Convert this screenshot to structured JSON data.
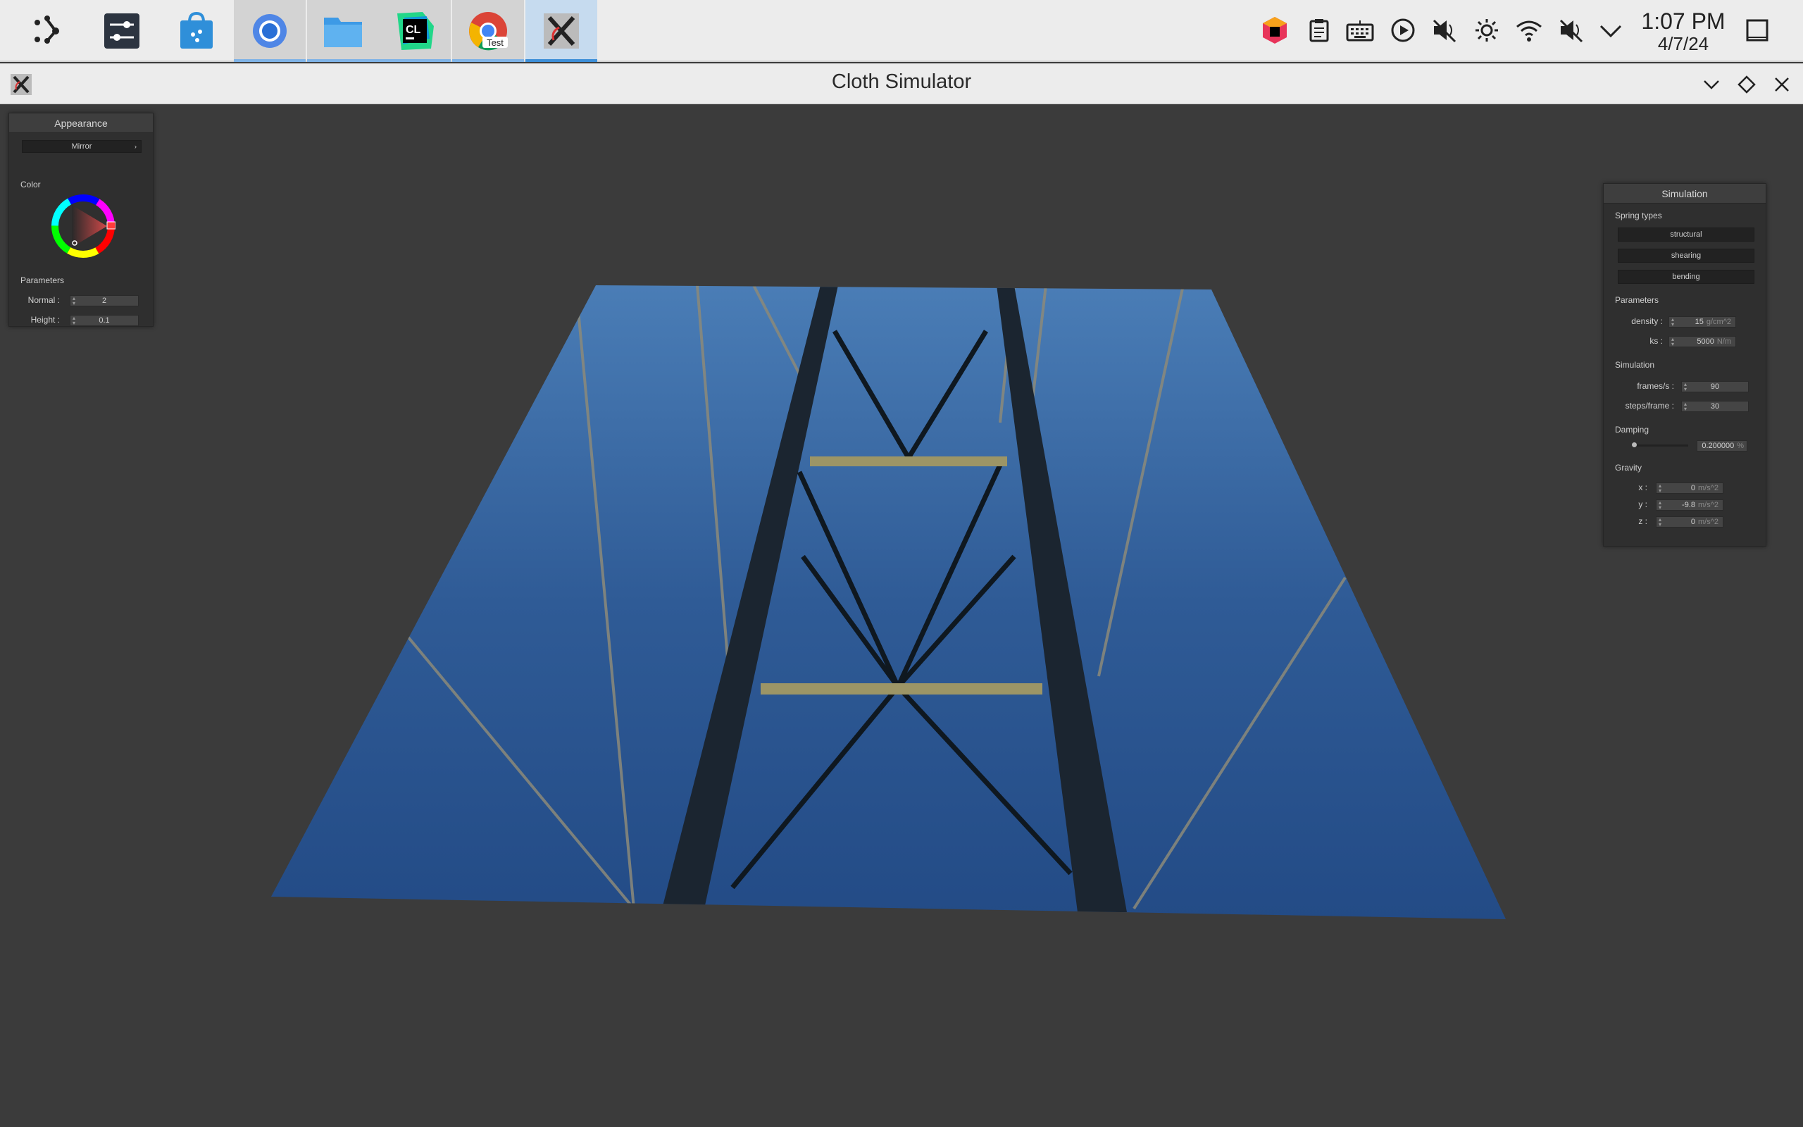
{
  "taskbar": {
    "apps": [
      {
        "name": "launcher-icon"
      },
      {
        "name": "settings-icon"
      },
      {
        "name": "app-store-icon"
      },
      {
        "name": "chromium-icon"
      },
      {
        "name": "files-icon"
      },
      {
        "name": "clion-icon",
        "badge": "CL"
      },
      {
        "name": "chrome-test-icon",
        "badge": "Test"
      },
      {
        "name": "x-app-icon"
      }
    ],
    "tray": [
      "jetbrains-toolbox-icon",
      "clipboard-icon",
      "keyboard-icon",
      "media-play-icon",
      "speaker-muted-icon",
      "brightness-icon",
      "wifi-icon",
      "microphone-muted-icon",
      "expand-icon"
    ],
    "time": "1:07 PM",
    "date": "4/7/24"
  },
  "window": {
    "title": "Cloth Simulator"
  },
  "appearance": {
    "header": "Appearance",
    "mode": "Mirror",
    "color_label": "Color",
    "parameters_label": "Parameters",
    "normal_label": "Normal :",
    "normal_value": "2",
    "height_label": "Height :",
    "height_value": "0.1"
  },
  "simulation": {
    "header": "Simulation",
    "spring_types_label": "Spring types",
    "spring_buttons": [
      "structural",
      "shearing",
      "bending"
    ],
    "parameters_label": "Parameters",
    "density_label": "density :",
    "density_value": "15",
    "density_unit": "g/cm^2",
    "ks_label": "ks :",
    "ks_value": "5000",
    "ks_unit": "N/m",
    "simulation_label": "Simulation",
    "fps_label": "frames/s :",
    "fps_value": "90",
    "steps_label": "steps/frame :",
    "steps_value": "30",
    "damping_label": "Damping",
    "damping_value": "0.200000",
    "damping_unit": "%",
    "gravity_label": "Gravity",
    "gx_label": "x :",
    "gx_value": "0",
    "gy_label": "y :",
    "gy_value": "-9.8",
    "gz_label": "z :",
    "gz_value": "0",
    "gravity_unit": "m/s^2"
  }
}
